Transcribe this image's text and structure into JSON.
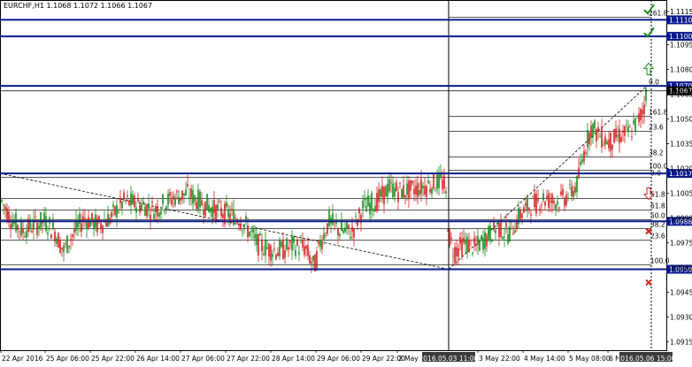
{
  "window": {
    "title": "EURCHF,H1  1.1068 1.1072 1.1066 1.1067"
  },
  "chart_data": {
    "type": "candlestick",
    "symbol": "EURCHF",
    "timeframe": "H1",
    "last_ohlc": {
      "open": 1.1068,
      "high": 1.1072,
      "low": 1.1066,
      "close": 1.1067
    },
    "ylim": [
      1.091,
      1.1122
    ],
    "y_ticks": [
      1.1115,
      1.1095,
      1.108,
      1.1065,
      1.105,
      1.1035,
      1.102,
      1.1005,
      1.099,
      1.0975,
      1.096,
      1.0945,
      1.093,
      1.0915
    ],
    "x_tick_labels": [
      "22 Apr 2016",
      "25 Apr 06:00",
      "25 Apr 22:00",
      "26 Apr 14:00",
      "27 Apr 06:00",
      "27 Apr 22:00",
      "28 Apr 14:00",
      "29 Apr 06:00",
      "29 Apr 22:00",
      "2 May 14:",
      "3 May 22:00",
      "4 May 14:00",
      "5 May 08:00",
      "6 Ma"
    ],
    "x_tick_positions": [
      0,
      50,
      101,
      152,
      203,
      254,
      305,
      356,
      407,
      448,
      539,
      590,
      641,
      686
    ],
    "highlight_labels": [
      {
        "text": "2016.05.03 11:00",
        "pos": 507
      },
      {
        "text": "2016.05.06 15:00",
        "pos": 730
      }
    ],
    "horizontal_levels": [
      {
        "price": 1.111,
        "label": "1.1110",
        "color": "#0a1a8c",
        "thick": true
      },
      {
        "price": 1.11,
        "label": "1.1100",
        "color": "#0a1a8c",
        "thick": true
      },
      {
        "price": 1.107,
        "label": "1.1070",
        "color": "#0a1a8c",
        "thick": true
      },
      {
        "price": 1.1067,
        "label": "1.1067",
        "color": "#000000",
        "thick": false
      },
      {
        "price": 1.1017,
        "label": "1.1017",
        "color": "#0a1a8c",
        "thick": true
      },
      {
        "price": 1.0988,
        "label": "1.0988",
        "color": "#0a1a8c",
        "thick": true
      },
      {
        "price": 1.0959,
        "label": "1.0959",
        "color": "#0a1a8c",
        "thick": true
      }
    ],
    "fib_levels_upper": [
      {
        "label": "261.8",
        "price": 1.1112
      },
      {
        "label": "0.0",
        "price": 1.107
      },
      {
        "label": "161.8",
        "price": 1.1052
      },
      {
        "label": "23.6",
        "price": 1.1043
      },
      {
        "label": "38.2",
        "price": 1.1027
      },
      {
        "label": "100.0",
        "price": 1.1019
      }
    ],
    "fib_levels_lower": [
      {
        "label": "0.0",
        "price": 1.1015
      },
      {
        "label": "61.8",
        "price": 1.1002
      },
      {
        "label": "61.8",
        "price": 1.0995
      },
      {
        "label": "50.0",
        "price": 1.0989
      },
      {
        "label": "38.2",
        "price": 1.0984
      },
      {
        "label": "23.6",
        "price": 1.0977
      },
      {
        "label": "100.0",
        "price": 1.0962
      }
    ],
    "markers": [
      {
        "type": "check",
        "price": 1.1116,
        "color": "#1a8a1a"
      },
      {
        "type": "check",
        "price": 1.1102,
        "color": "#1a8a1a"
      },
      {
        "type": "arrow-up",
        "price": 1.108,
        "color": "#1a8a1a"
      },
      {
        "type": "arrow-down",
        "price": 1.1005,
        "color": "#d22020"
      },
      {
        "type": "cross",
        "price": 1.0982,
        "color": "#d22020"
      },
      {
        "type": "cross",
        "price": 1.0951,
        "color": "#d22020"
      }
    ],
    "candle_path": [
      [
        0,
        1.1002
      ],
      [
        12,
        1.099
      ],
      [
        25,
        1.0982
      ],
      [
        35,
        1.0985
      ],
      [
        50,
        1.0988
      ],
      [
        62,
        1.0982
      ],
      [
        72,
        1.097
      ],
      [
        80,
        1.0978
      ],
      [
        95,
        1.099
      ],
      [
        110,
        1.0986
      ],
      [
        125,
        1.099
      ],
      [
        140,
        1.1
      ],
      [
        160,
        1.0998
      ],
      [
        175,
        1.0995
      ],
      [
        195,
        1.1002
      ],
      [
        212,
        1.1005
      ],
      [
        225,
        1.1
      ],
      [
        240,
        1.0996
      ],
      [
        255,
        1.0993
      ],
      [
        270,
        1.099
      ],
      [
        282,
        1.0982
      ],
      [
        290,
        1.0975
      ],
      [
        300,
        1.0972
      ],
      [
        315,
        1.097
      ],
      [
        330,
        1.0973
      ],
      [
        345,
        1.0972
      ],
      [
        355,
        1.096
      ],
      [
        362,
        1.0975
      ],
      [
        372,
        1.0988
      ],
      [
        385,
        1.0982
      ],
      [
        398,
        1.0982
      ],
      [
        410,
        1.0996
      ],
      [
        425,
        1.1
      ],
      [
        440,
        1.1008
      ],
      [
        455,
        1.1006
      ],
      [
        470,
        1.1008
      ],
      [
        485,
        1.101
      ],
      [
        498,
        1.1012
      ],
      [
        503,
        1.101
      ],
      [
        507,
        1.098
      ],
      [
        513,
        1.097
      ],
      [
        525,
        1.0975
      ],
      [
        538,
        1.0972
      ],
      [
        550,
        1.0978
      ],
      [
        562,
        1.0985
      ],
      [
        575,
        1.098
      ],
      [
        588,
        1.0992
      ],
      [
        600,
        1.0998
      ],
      [
        615,
        1.1002
      ],
      [
        630,
        1.1
      ],
      [
        643,
        1.1004
      ],
      [
        652,
        1.101
      ],
      [
        660,
        1.103
      ],
      [
        668,
        1.1045
      ],
      [
        678,
        1.104
      ],
      [
        688,
        1.1036
      ],
      [
        700,
        1.104
      ],
      [
        712,
        1.1042
      ],
      [
        720,
        1.1048
      ],
      [
        727,
        1.1056
      ],
      [
        731,
        1.1067
      ]
    ],
    "trend_lines": [
      {
        "from": [
          0,
          1.1017
        ],
        "to": [
          507,
          1.0959
        ],
        "style": "dashed"
      },
      {
        "from": [
          507,
          1.0959
        ],
        "to": [
          731,
          1.107
        ],
        "style": "dashed"
      }
    ],
    "vertical_lines": [
      507,
      736
    ]
  }
}
